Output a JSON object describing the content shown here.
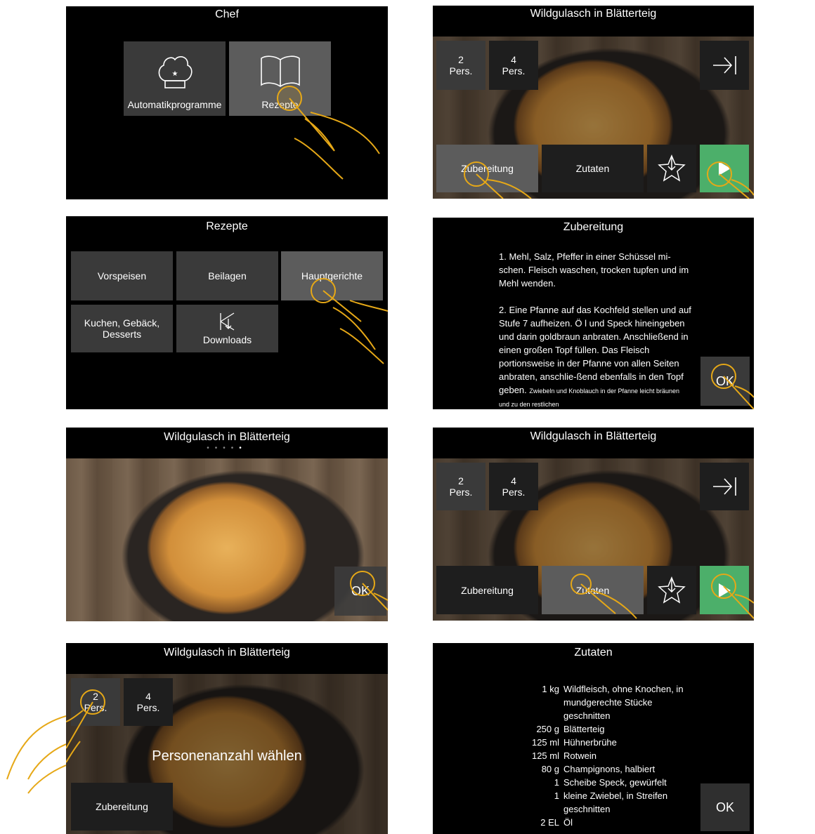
{
  "screen1": {
    "title": "Chef",
    "tiles": [
      "Automatikprogramme",
      "Rezepte"
    ]
  },
  "screen2": {
    "title": "Wildgulasch in Blätterteig",
    "pers": [
      "2",
      "Pers.",
      "4",
      "Pers."
    ],
    "prep": "Zubereitung",
    "ing": "Zutaten"
  },
  "screen3": {
    "title": "Rezepte",
    "tiles": [
      "Vorspeisen",
      "Beilagen",
      "Hauptgerichte",
      "Kuchen, Gebäck, Desserts",
      "Downloads"
    ]
  },
  "screen4": {
    "title": "Zubereitung",
    "step1": "1. Mehl, Salz, Pfeffer in einer Schüssel mi-schen. Fleisch waschen, trocken tupfen und im Mehl wenden.",
    "step2": "2. Eine Pfanne auf das Kochfeld stellen und auf Stufe 7 aufheizen. Ö l und Speck hineingeben und darin goldbraun anbraten. Anschließend in einen großen Topf füllen. Das Fleisch portionsweise in der Pfanne von allen Seiten anbraten, anschlie-ßend ebenfalls in den Topf geben.",
    "step2_small": "Zwiebeln und Knoblauch in der Pfanne leicht bräunen und zu den restlichen",
    "ok": "OK"
  },
  "screen5": {
    "title": "Wildgulasch in Blätterteig",
    "ok": "OK",
    "dots": "•••••"
  },
  "screen6": {
    "title": "Wildgulasch in Blätterteig",
    "pers": [
      "2",
      "Pers.",
      "4",
      "Pers."
    ],
    "prep": "Zubereitung",
    "ing": "Zutaten"
  },
  "screen7": {
    "title": "Wildgulasch in Blätterteig",
    "pers": [
      "2",
      "Pers.",
      "4",
      "Pers."
    ],
    "overlay": "Personenanzahl wählen",
    "prep": "Zubereitung"
  },
  "screen8": {
    "title": "Zutaten",
    "ok": "OK",
    "items": [
      {
        "q": "1 kg",
        "d": "Wildfleisch, ohne Knochen, in mundgerechte Stücke geschnitten"
      },
      {
        "q": "250 g",
        "d": "Blätterteig"
      },
      {
        "q": "125 ml",
        "d": "Hühnerbrühe"
      },
      {
        "q": "125 ml",
        "d": "Rotwein"
      },
      {
        "q": "80 g",
        "d": "Champignons, halbiert"
      },
      {
        "q": "1",
        "d": "Scheibe Speck, gewürfelt"
      },
      {
        "q": "1",
        "d": "kleine Zwiebel, in Streifen geschnitten"
      },
      {
        "q": "2 EL",
        "d": "Öl"
      }
    ]
  }
}
